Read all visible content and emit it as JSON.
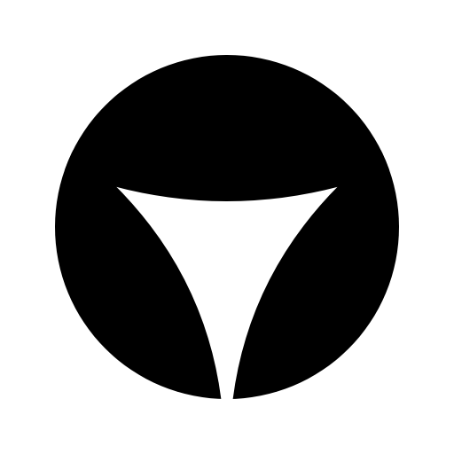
{
  "logo": {
    "icon": "circle-trefoil-mark-icon",
    "foreground_color": "#000000",
    "background_color": "#ffffff"
  }
}
